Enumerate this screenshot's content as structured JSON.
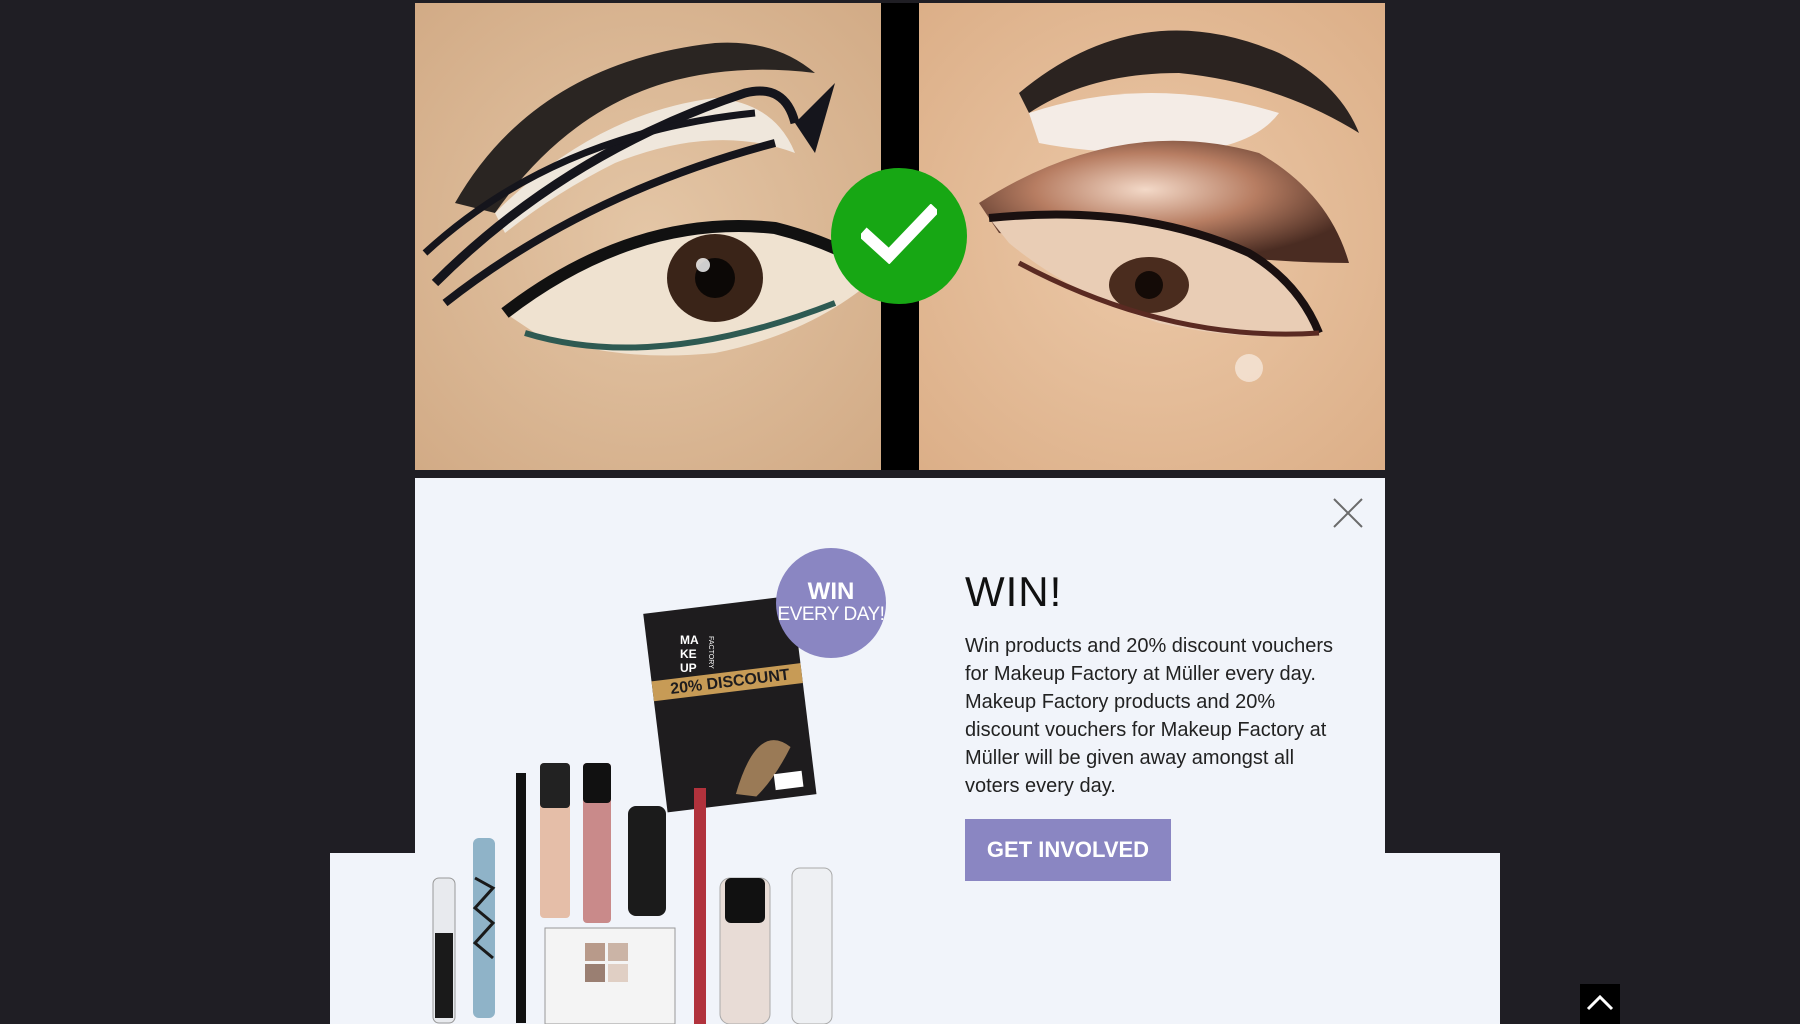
{
  "comparison": {
    "left_image": "eye-makeup-graphic-liner-photo",
    "right_image": "eye-makeup-smokey-shimmer-photo",
    "badge_icon": "checkmark-icon",
    "badge_color": "#17a714"
  },
  "popup": {
    "close_icon": "close-icon",
    "badge": {
      "line1": "WIN",
      "line2": "EVERY DAY!"
    },
    "voucher": {
      "brand_lines": [
        "MA",
        "KE",
        "UP"
      ],
      "brand_side": "FACTORY",
      "discount": "20% DISCOUNT"
    },
    "title": "WIN!",
    "body": "Win products and 20% discount vouchers for Makeup Factory at Müller every day. Makeup Factory products and 20% discount vouchers for Makeup Factory at Müller will be given away amongst all voters every day.",
    "cta_label": "GET INVOLVED",
    "accent_color": "#8a86c2",
    "background_color": "#f1f4fa"
  },
  "scroll_top": {
    "icon": "chevron-up-icon"
  }
}
